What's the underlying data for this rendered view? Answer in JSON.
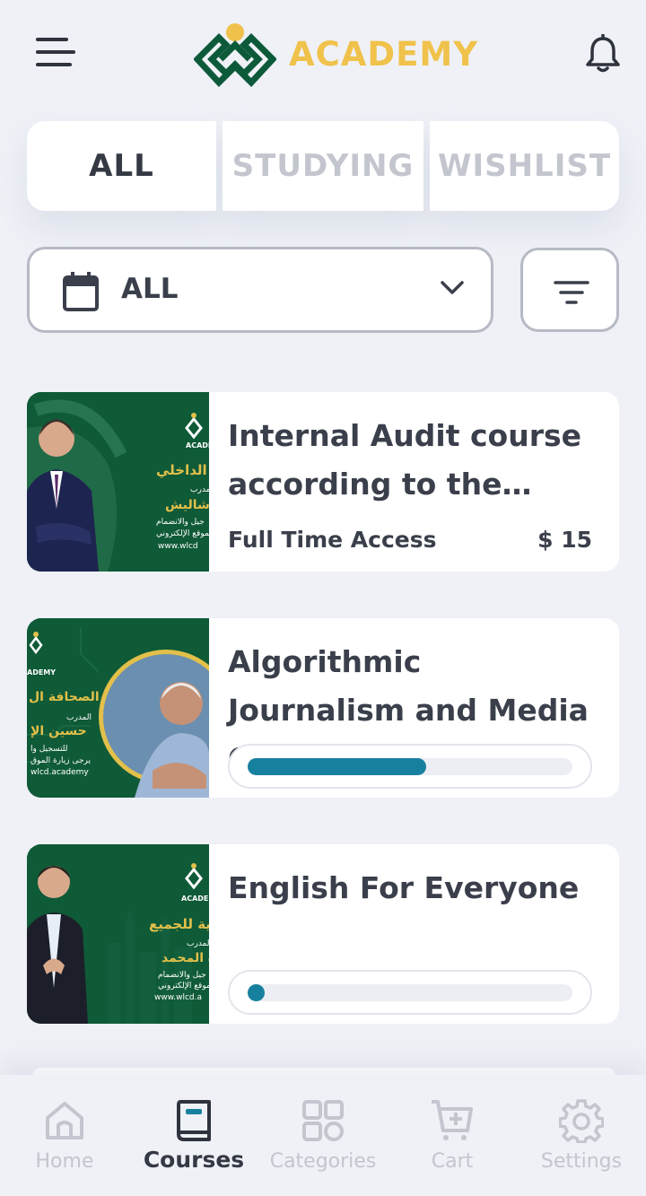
{
  "header": {
    "logo_text": "ACADEMY",
    "brand_color": "#f0c24b",
    "logo_green": "#0d5a3a"
  },
  "tabs": [
    {
      "label": "ALL",
      "active": true
    },
    {
      "label": "STUDYING",
      "active": false
    },
    {
      "label": "WISHLIST",
      "active": false
    }
  ],
  "filters": {
    "date_value": "ALL"
  },
  "courses": [
    {
      "title": "Internal Audit course according to the international standards",
      "access": "Full Time Access",
      "price": "$ 15"
    },
    {
      "title": "Algorithmic Journalism and Media Content",
      "progress": 0.55
    },
    {
      "title": "English For Everyone",
      "progress": 0.05
    }
  ],
  "thumbnails": [
    {
      "arabic_title": "ق الداخلي",
      "trainer_label": "المدرب",
      "trainer": "ر شاليش",
      "line1": "جيل والانضمام",
      "line2": "الموقع الإلكتروني",
      "url": "www.wlcd",
      "logo_label": "ACADE"
    },
    {
      "arabic_title": "الصحافة ال",
      "trainer_label": "المدرب",
      "trainer": "حسين الإ",
      "line1": "للتسجيل وا",
      "line2": "يرجى زيارة الموق",
      "url": "wlcd.academy",
      "logo_label": "ADEMY"
    },
    {
      "arabic_title": "زية للجميع",
      "trainer_label": "المدرب",
      "trainer": "ة المحمد",
      "line1": "جيل والانضمام",
      "line2": "الموقع الإلكتروني",
      "url": "www.wlcd.a",
      "logo_label": "ACADEM"
    }
  ],
  "bottom_nav": [
    {
      "label": "Home",
      "icon": "home-icon",
      "active": false
    },
    {
      "label": "Courses",
      "icon": "book-icon",
      "active": true
    },
    {
      "label": "Categories",
      "icon": "grid-icon",
      "active": false
    },
    {
      "label": "Cart",
      "icon": "cart-icon",
      "active": false
    },
    {
      "label": "Settings",
      "icon": "gear-icon",
      "active": false
    }
  ],
  "colors": {
    "accent": "#17809e",
    "text": "#3a3f4b",
    "inactive": "#c3c6ce",
    "thumb_green": "#0f5a37",
    "thumb_gold": "#e2c04a"
  }
}
